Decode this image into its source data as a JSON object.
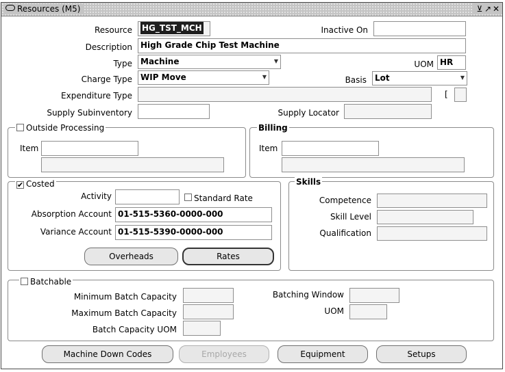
{
  "window": {
    "title": "Resources (M5)"
  },
  "header": {
    "resource_label": "Resource",
    "resource_value": "HG_TST_MCH",
    "inactive_label": "Inactive On",
    "inactive_value": "",
    "description_label": "Description",
    "description_value": "High Grade Chip Test Machine",
    "type_label": "Type",
    "type_value": "Machine",
    "uom_label": "UOM",
    "uom_value": "HR",
    "charge_label": "Charge Type",
    "charge_value": "WIP Move",
    "basis_label": "Basis",
    "basis_value": "Lot",
    "expenditure_label": "Expenditure Type",
    "expenditure_value": "",
    "bracket": "[",
    "supply_sub_label": "Supply Subinventory",
    "supply_sub_value": "",
    "supply_loc_label": "Supply Locator",
    "supply_loc_value": ""
  },
  "outside": {
    "title": "Outside Processing",
    "item_label": "Item",
    "checked": false
  },
  "billing": {
    "title": "Billing",
    "item_label": "Item"
  },
  "costed": {
    "title": "Costed",
    "checked": true,
    "activity_label": "Activity",
    "standard_rate_label": "Standard Rate",
    "absorption_label": "Absorption Account",
    "absorption_value": "01-515-5360-0000-000",
    "variance_label": "Variance Account",
    "variance_value": "01-515-5390-0000-000",
    "overheads_label": "Overheads",
    "rates_label": "Rates"
  },
  "skills": {
    "title": "Skills",
    "competence_label": "Competence",
    "skill_level_label": "Skill Level",
    "qualification_label": "Qualification"
  },
  "batch": {
    "title": "Batchable",
    "checked": false,
    "min_label": "Minimum Batch Capacity",
    "max_label": "Maximum Batch Capacity",
    "uom_cap_label": "Batch Capacity UOM",
    "window_label": "Batching Window",
    "uom_label": "UOM"
  },
  "buttons": {
    "machine_down": "Machine Down Codes",
    "employees": "Employees",
    "equipment": "Equipment",
    "setups": "Setups"
  },
  "icons": {
    "dropdown": "chevron-down-icon",
    "checkbox": "checkbox-icon"
  }
}
